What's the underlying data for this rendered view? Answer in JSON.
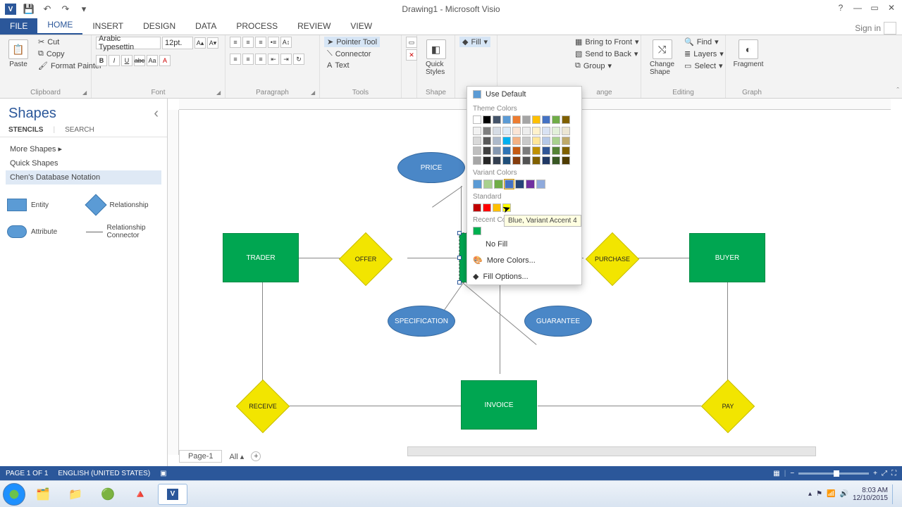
{
  "titlebar": {
    "document": "Drawing1 - Microsoft Visio",
    "help": "?",
    "min": "—",
    "max": "▭",
    "close": "✕"
  },
  "tabs": {
    "file": "FILE",
    "home": "HOME",
    "insert": "INSERT",
    "design": "DESIGN",
    "data": "DATA",
    "process": "PROCESS",
    "review": "REVIEW",
    "view": "VIEW",
    "signin": "Sign in"
  },
  "ribbon": {
    "clipboard": {
      "paste": "Paste",
      "cut": "Cut",
      "copy": "Copy",
      "format_painter": "Format Painter",
      "label": "Clipboard"
    },
    "font": {
      "family": "Arabic Typesettin",
      "size": "12pt.",
      "bold": "B",
      "italic": "I",
      "underline": "U",
      "strike": "abc",
      "label": "Font"
    },
    "paragraph": {
      "label": "Paragraph"
    },
    "tools": {
      "pointer": "Pointer Tool",
      "connector": "Connector",
      "text": "Text",
      "label": "Tools"
    },
    "shape_styles": {
      "quick": "Quick Styles",
      "fill": "Fill",
      "label": "Shape"
    },
    "arrange": {
      "bring_front": "Bring to Front",
      "send_back": "Send to Back",
      "group": "Group",
      "label": "ange"
    },
    "editing": {
      "change_shape": "Change Shape",
      "find": "Find",
      "layers": "Layers",
      "select": "Select",
      "label": "Editing"
    },
    "graph": {
      "fragment": "Fragment",
      "label": "Graph"
    }
  },
  "shapes_pane": {
    "title": "Shapes",
    "tab_stencils": "STENCILS",
    "tab_search": "SEARCH",
    "more_shapes": "More Shapes",
    "quick_shapes": "Quick Shapes",
    "chens": "Chen's Database Notation",
    "stencils": {
      "entity": "Entity",
      "relationship": "Relationship",
      "attribute": "Attribute",
      "rel_conn": "Relationship Connector"
    }
  },
  "fill_menu": {
    "use_default": "Use Default",
    "theme_colors": "Theme Colors",
    "variant_colors": "Variant Colors",
    "standard": "Standard",
    "recent_colors": "Recent Colors",
    "no_fill": "No Fill",
    "more_colors": "More Colors...",
    "fill_options": "Fill Options...",
    "tooltip": "Blue, Variant Accent 4",
    "standard_colors": [
      "#c00000",
      "#ff0000",
      "#ffc000",
      "#ffff00"
    ],
    "variant_colors_list": [
      "#5b9bd5",
      "#a9d18e",
      "#70ad47",
      "#4472c4",
      "#264478",
      "#7030a0",
      "#8faadc"
    ],
    "recent_list": [
      "#00b050"
    ]
  },
  "er": {
    "entities": {
      "trader": "TRADER",
      "invoice": "INVOICE",
      "buyer": "BUYER"
    },
    "attributes": {
      "price": "PRICE",
      "specification": "SPECIFICATION",
      "guarantee": "GUARANTEE"
    },
    "relationships": {
      "offer": "OFFER",
      "purchase": "PURCHASE",
      "receive": "RECEIVE",
      "pay": "PAY"
    }
  },
  "page_tabs": {
    "page1": "Page-1",
    "all": "All"
  },
  "status": {
    "page": "PAGE 1 OF 1",
    "lang": "ENGLISH (UNITED STATES)"
  },
  "taskbar": {
    "time": "8:03 AM",
    "date": "12/10/2015"
  }
}
